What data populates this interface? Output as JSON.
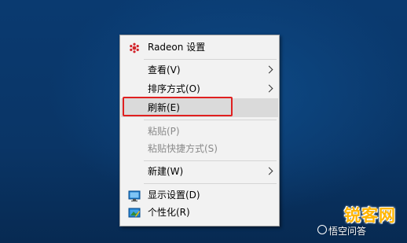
{
  "context_menu": {
    "items": [
      {
        "label": "Radeon 设置",
        "icon": "radeon-icon"
      },
      {
        "label": "查看(V)",
        "has_submenu": true
      },
      {
        "label": "排序方式(O)",
        "has_submenu": true
      },
      {
        "label": "刷新(E)",
        "highlighted": true
      },
      {
        "label": "粘贴(P)",
        "disabled": true
      },
      {
        "label": "粘贴快捷方式(S)",
        "disabled": true
      },
      {
        "label": "新建(W)",
        "has_submenu": true
      },
      {
        "label": "显示设置(D)",
        "icon": "display-icon"
      },
      {
        "label": "个性化(R)",
        "icon": "personalize-icon"
      }
    ]
  },
  "watermark": {
    "brand": "锐客网",
    "sub": "悟空问答"
  },
  "colors": {
    "highlight_border": "#e02020",
    "brand": "#ffb400"
  }
}
